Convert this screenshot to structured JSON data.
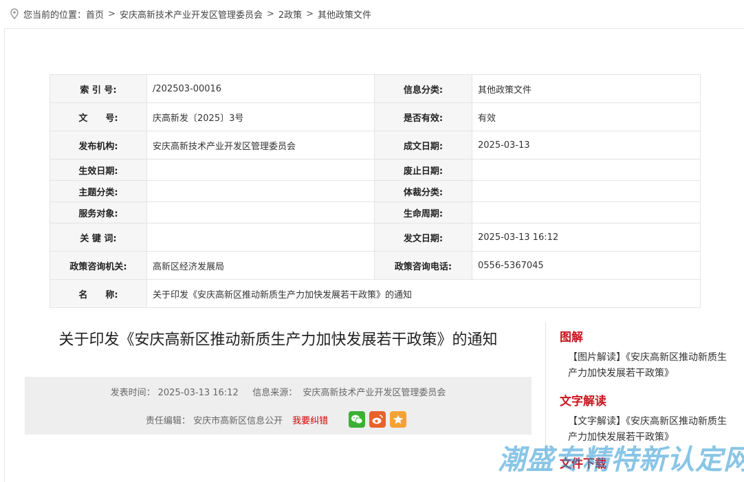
{
  "breadcrumb": {
    "prefix": "您当前的位置：",
    "items": [
      "首页",
      "安庆高新技术产业开发区管理委员会",
      "2政策",
      "其他政策文件"
    ],
    "separator": ">"
  },
  "info_table": {
    "rows": [
      {
        "k1": "索 引 号:",
        "v1": "/202503-00016",
        "k2": "信息分类:",
        "v2": "其他政策文件"
      },
      {
        "k1": "文　　号:",
        "v1": "庆高新发〔2025〕3号",
        "k2": "是否有效:",
        "v2": "有效"
      },
      {
        "k1": "发布机构:",
        "v1": "安庆高新技术产业开发区管理委员会",
        "k2": "成文日期:",
        "v2": "2025-03-13"
      },
      {
        "k1": "生效日期:",
        "v1": "",
        "k2": "废止日期:",
        "v2": ""
      },
      {
        "k1": "主题分类:",
        "v1": "",
        "k2": "体裁分类:",
        "v2": ""
      },
      {
        "k1": "服务对象:",
        "v1": "",
        "k2": "生命周期:",
        "v2": ""
      },
      {
        "k1": "关 键 词:",
        "v1": "",
        "k2": "发文日期:",
        "v2": "2025-03-13 16:12"
      },
      {
        "k1": "政策咨询机关:",
        "v1": "高新区经济发展局",
        "k2": "政策咨询电话:",
        "v2": "0556-5367045"
      }
    ],
    "name_row": {
      "k": "名　　称:",
      "v": "关于印发《安庆高新区推动新质生产力加快发展若干政策》的通知"
    }
  },
  "article": {
    "title": "关于印发《安庆高新区推动新质生产力加快发展若干政策》的通知",
    "publish_label": "发表时间：",
    "publish_time": "2025-03-13 16:12",
    "source_label": "信息来源：",
    "source": "安庆高新技术产业开发区管理委员会",
    "editor_label": "责任编辑：",
    "editor": "安庆市高新区信息公开",
    "error_link": "我要纠错",
    "share_icons": [
      "wechat-icon",
      "weibo-icon",
      "favorite-icon"
    ]
  },
  "sidebar": {
    "sections": [
      {
        "heading": "图解",
        "link": "【图片解读】《安庆高新区推动新质生产力加快发展若干政策》"
      },
      {
        "heading": "文字解读",
        "link": "【文字解读】《安庆高新区推动新质生产力加快发展若干政策》"
      },
      {
        "heading": "文件下载"
      }
    ]
  },
  "watermark": "潮盛专精特新认定网",
  "colors": {
    "accent_red": "#c9151e",
    "error_red": "#d40000",
    "wechat": "#3cb034",
    "weibo": "#e8622a",
    "favorite": "#f3a336"
  }
}
